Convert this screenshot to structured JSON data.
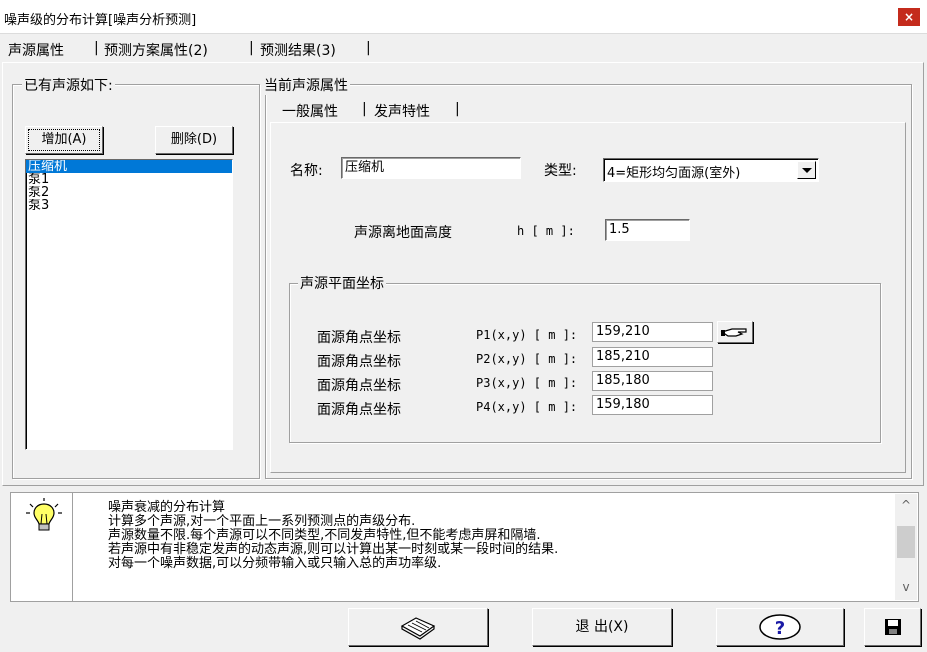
{
  "window": {
    "title": "噪声级的分布计算[噪声分析预测]",
    "close_glyph": "×"
  },
  "top_tabs": [
    {
      "label": "声源属性"
    },
    {
      "label": "预测方案属性(2)"
    },
    {
      "label": "预测结果(3)"
    }
  ],
  "tab_separator": "|",
  "existing_sources": {
    "group_label": "已有声源如下:",
    "add_button": "增加(A)",
    "delete_button": "删除(D)",
    "items": [
      "压缩机",
      "泵1",
      "泵2",
      "泵3"
    ],
    "selected_index": 0
  },
  "current_source": {
    "group_label": "当前声源属性",
    "sub_tabs": [
      {
        "label": "一般属性"
      },
      {
        "label": "发声特性"
      }
    ],
    "name_label": "名称:",
    "name_value": "压缩机",
    "type_label": "类型:",
    "type_value": "4=矩形均匀面源(室外)",
    "height_label": "声源离地面高度",
    "height_unit": "h [ m ]:",
    "height_value": "1.5",
    "plane_group_label": "声源平面坐标",
    "corners": [
      {
        "label": "面源角点坐标",
        "point": "P1(x,y) [ m ]:",
        "value": "159,210"
      },
      {
        "label": "面源角点坐标",
        "point": "P2(x,y) [ m ]:",
        "value": "185,210"
      },
      {
        "label": "面源角点坐标",
        "point": "P3(x,y) [ m ]:",
        "value": "185,180"
      },
      {
        "label": "面源角点坐标",
        "point": "P4(x,y) [ m ]:",
        "value": "159,180"
      }
    ]
  },
  "info": {
    "lines": [
      "噪声衰减的分布计算",
      "计算多个声源,对一个平面上一系列预测点的声级分布.",
      "声源数量不限.每个声源可以不同类型,不同发声特性,但不能考虑声屏和隔墙.",
      "若声源中有非稳定发声的动态声源,则可以计算出某一时刻或某一段时间的结果.",
      "对每一个噪声数据,可以分频带输入或只输入总的声功率级."
    ],
    "scroll_up": "^",
    "scroll_down": "v"
  },
  "footer": {
    "exit_button": "退 出(X)",
    "help_glyph": "?"
  },
  "colors": {
    "selection": "#0078d7",
    "close_button": "#c42b1c",
    "window_bg": "#f0f0f0"
  }
}
